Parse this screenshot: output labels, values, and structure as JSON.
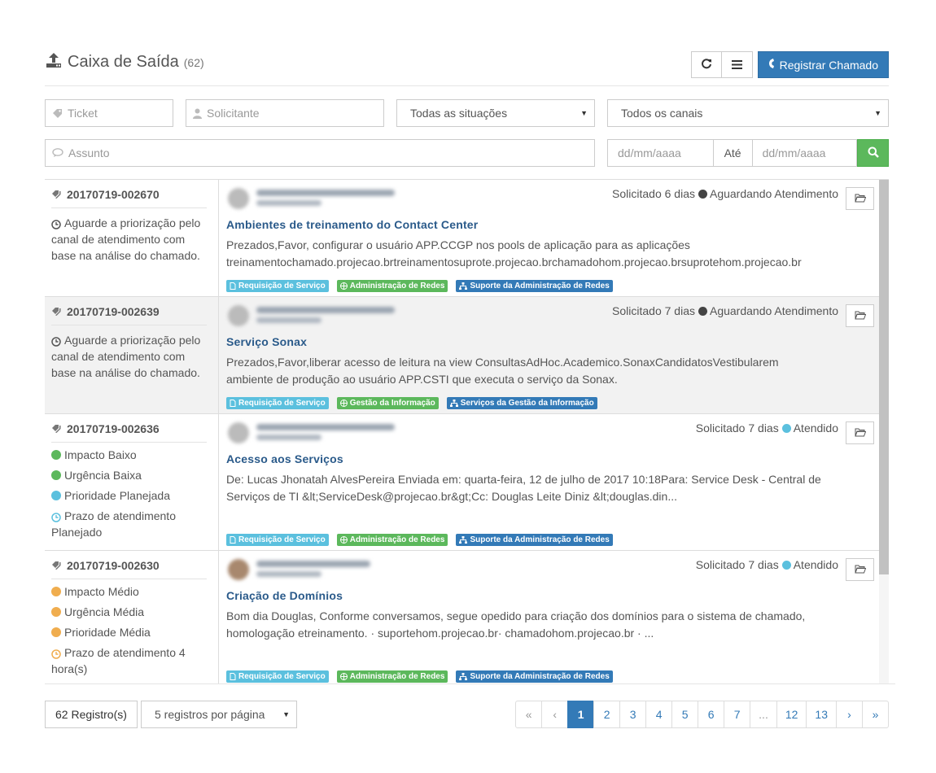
{
  "header": {
    "title": "Caixa de Saída",
    "count": "(62)",
    "register_label": "Registrar Chamado"
  },
  "filters": {
    "ticket_placeholder": "Ticket",
    "solicitante_placeholder": "Solicitante",
    "situacao_selected": "Todas as situações",
    "canal_selected": "Todos os canais",
    "assunto_placeholder": "Assunto",
    "date_from_placeholder": "dd/mm/aaaa",
    "ate_label": "Até",
    "date_to_placeholder": "dd/mm/aaaa"
  },
  "tickets": [
    {
      "id": "20170719-002670",
      "note": "Aguarde a priorização pelo canal de atendimento com base na análise do chamado.",
      "solicitado": "Solicitado 6 dias",
      "status": "Aguardando Atendimento",
      "status_color": "#444444",
      "subject": "Ambientes de treinamento do Contact Center",
      "description": "Prezados,Favor, configurar o usuário APP.CCGP nos pools de aplicação para as aplicações treinamentochamado.projecao.brtreinamentosuprote.projecao.brchamadohom.projecao.brsuprotehom.projecao.br",
      "labels": [
        "Requisição de Serviço",
        "Administração de Redes",
        "Suporte da Administração de Redes"
      ]
    },
    {
      "id": "20170719-002639",
      "note": "Aguarde a priorização pelo canal de atendimento com base na análise do chamado.",
      "solicitado": "Solicitado 7 dias",
      "status": "Aguardando Atendimento",
      "status_color": "#444444",
      "subject": "Serviço Sonax",
      "description": "Prezados,Favor,liberar acesso de leitura na view ConsultasAdHoc.Academico.SonaxCandidatosVestibularem ambiente de produção ao usuário APP.CSTI que executa o serviço da Sonax.",
      "labels": [
        "Requisição de Serviço",
        "Gestão da Informação",
        "Serviços da Gestão da Informação"
      ]
    },
    {
      "id": "20170719-002636",
      "impacto": "Impacto Baixo",
      "urgencia": "Urgência Baixa",
      "prioridade": "Prioridade Planejada",
      "prazo": "Prazo de atendimento Planejado",
      "impact_color": "#5cb85c",
      "priority_color": "#5bc0de",
      "solicitado": "Solicitado 7 dias",
      "status": "Atendido",
      "status_color": "#5bc0de",
      "subject": "Acesso aos Serviços",
      "description": "De: Lucas Jhonatah AlvesPereira Enviada em: quarta-feira, 12 de julho de 2017 10:18Para: Service Desk - Central de Serviços de TI &lt;ServiceDesk@projecao.br&gt;Cc: Douglas Leite Diniz &lt;douglas.din...",
      "labels": [
        "Requisição de Serviço",
        "Administração de Redes",
        "Suporte da Administração de Redes"
      ]
    },
    {
      "id": "20170719-002630",
      "impacto": "Impacto Médio",
      "urgencia": "Urgência Média",
      "prioridade": "Prioridade Média",
      "prazo": "Prazo de atendimento 4 hora(s)",
      "impact_color": "#f0ad4e",
      "priority_color": "#f0ad4e",
      "solicitado": "Solicitado 7 dias",
      "status": "Atendido",
      "status_color": "#5bc0de",
      "subject": "Criação de Domínios",
      "description": "Bom dia Douglas, Conforme conversamos, segue opedido para criação dos domínios para o sistema de chamado, homologação etreinamento. · suportehom.projecao.br· chamadohom.projecao.br · ...",
      "labels": [
        "Requisição de Serviço",
        "Administração de Redes",
        "Suporte da Administração de Redes"
      ]
    }
  ],
  "footer": {
    "records": "62 Registro(s)",
    "per_page": "5 registros por página",
    "pages": [
      "«",
      "‹",
      "1",
      "2",
      "3",
      "4",
      "5",
      "6",
      "7",
      "...",
      "12",
      "13",
      "›",
      "»"
    ],
    "active_page": "1"
  },
  "colors": {
    "primary": "#337ab7",
    "success": "#5cb85c",
    "info": "#5bc0de",
    "warning": "#f0ad4e"
  },
  "icons": {
    "title": "upload-icon",
    "refresh": "refresh-icon",
    "menu": "menu-icon",
    "phone": "phone-icon",
    "search": "search-icon",
    "folder": "folder-icon"
  }
}
